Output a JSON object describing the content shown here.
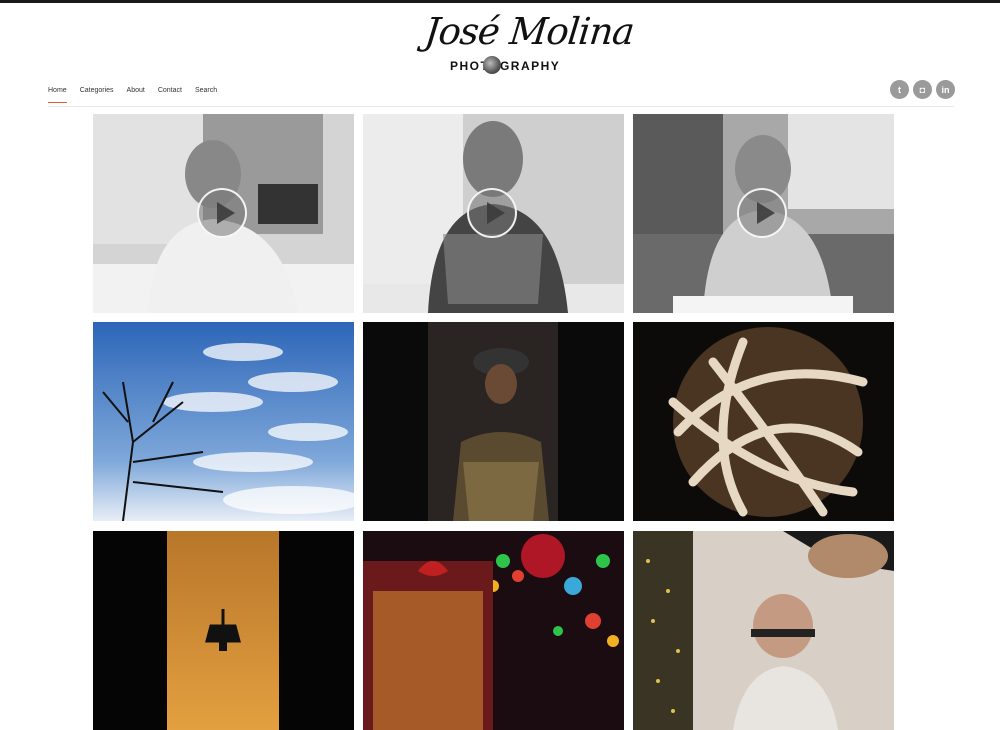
{
  "brand": {
    "name": "José Molina",
    "tagline": "PHOTOGRAPHY"
  },
  "nav": {
    "items": [
      {
        "label": "Home",
        "active": true
      },
      {
        "label": "Categories"
      },
      {
        "label": "About"
      },
      {
        "label": "Contact"
      },
      {
        "label": "Search"
      }
    ]
  },
  "social": [
    {
      "icon": "twitter-icon",
      "glyph": "t"
    },
    {
      "icon": "instagram-icon",
      "glyph": "◘"
    },
    {
      "icon": "linkedin-icon",
      "glyph": "in"
    }
  ],
  "gallery": [
    {
      "subject": "woman-portrait-video-1",
      "video": true
    },
    {
      "subject": "woman-portrait-video-2",
      "video": true
    },
    {
      "subject": "woman-portrait-video-3",
      "video": true
    },
    {
      "subject": "tree-and-sky"
    },
    {
      "subject": "woman-in-hat"
    },
    {
      "subject": "wicker-ball"
    },
    {
      "subject": "sunset-tower"
    },
    {
      "subject": "holiday-bokeh"
    },
    {
      "subject": "man-with-glasses"
    }
  ],
  "colors": {
    "accent": "#e05a3a",
    "icon_bg": "#9a9a9a"
  }
}
